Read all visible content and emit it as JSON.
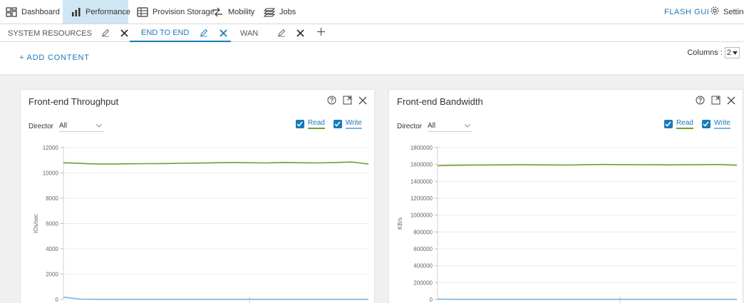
{
  "nav": {
    "dashboard": "Dashboard",
    "performance": "Performance",
    "provision_storage": "Provision Storage",
    "mobility": "Mobility",
    "jobs": "Jobs",
    "brand": "FLASH GUI",
    "settings": "Settings"
  },
  "tabs": [
    {
      "label": "SYSTEM RESOURCES",
      "active": false
    },
    {
      "label": "END TO END",
      "active": true
    },
    {
      "label": "WAN",
      "active": false
    }
  ],
  "toolbar": {
    "add_content": "+ ADD CONTENT",
    "columns_label": "Columns :",
    "columns_value": "2"
  },
  "panels": [
    {
      "title": "Front-end Throughput",
      "director_label": "Director",
      "director_value": "All",
      "legend_read": "Read",
      "legend_write": "Write"
    },
    {
      "title": "Front-end Bandwidth",
      "director_label": "Director",
      "director_value": "All",
      "legend_read": "Read",
      "legend_write": "Write"
    }
  ],
  "colors": {
    "accent": "#1a7ab7",
    "read_series": "#6aa12c",
    "write_series": "#7ab4e0"
  },
  "chart_data": [
    {
      "type": "line",
      "title": "Front-end Throughput",
      "xlabel": "",
      "ylabel": "IOs/sec",
      "ylim": [
        0,
        12000
      ],
      "yticks": [
        "12000",
        "10000",
        "8000",
        "6000",
        "4000",
        "2000",
        "0"
      ],
      "x": [
        0,
        1,
        2,
        3,
        4,
        5,
        6,
        7,
        8,
        9,
        10,
        11,
        12,
        13,
        14,
        15,
        16,
        17,
        18
      ],
      "series": [
        {
          "name": "Read",
          "values": [
            10800,
            10750,
            10700,
            10700,
            10720,
            10730,
            10740,
            10760,
            10780,
            10800,
            10820,
            10800,
            10790,
            10820,
            10800,
            10790,
            10810,
            10860,
            10700
          ]
        },
        {
          "name": "Write",
          "values": [
            180,
            30,
            10,
            10,
            10,
            10,
            10,
            10,
            10,
            10,
            10,
            10,
            10,
            10,
            10,
            10,
            10,
            10,
            10
          ]
        }
      ],
      "grid": true,
      "legend": "top-right"
    },
    {
      "type": "line",
      "title": "Front-end Bandwidth",
      "xlabel": "",
      "ylabel": "KB/s",
      "ylim": [
        0,
        1800000
      ],
      "yticks": [
        "1800000",
        "1600000",
        "1400000",
        "1200000",
        "1000000",
        "800000",
        "600000",
        "400000",
        "200000",
        "0"
      ],
      "x": [
        0,
        1,
        2,
        3,
        4,
        5,
        6,
        7,
        8,
        9,
        10,
        11,
        12,
        13,
        14,
        15,
        16,
        17,
        18
      ],
      "series": [
        {
          "name": "Read",
          "values": [
            1585000,
            1590000,
            1592000,
            1594000,
            1595000,
            1596000,
            1595000,
            1594000,
            1593000,
            1598000,
            1600000,
            1598000,
            1597000,
            1596000,
            1595000,
            1596000,
            1598000,
            1600000,
            1590000
          ]
        },
        {
          "name": "Write",
          "values": [
            3000,
            2000,
            2000,
            2000,
            2000,
            2000,
            2000,
            2000,
            2000,
            2000,
            2000,
            2000,
            2000,
            2000,
            2000,
            2000,
            2000,
            2000,
            2000
          ]
        }
      ],
      "grid": true,
      "legend": "top-right"
    }
  ]
}
